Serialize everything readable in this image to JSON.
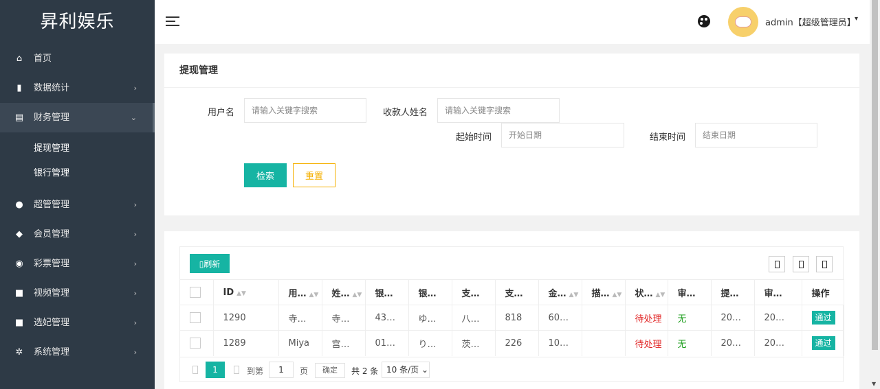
{
  "sidebar": {
    "logo": "昇利娱乐",
    "items": [
      {
        "label": "首页",
        "icon": "home-icon",
        "glyph": "⌂",
        "arrow": ""
      },
      {
        "label": "数据统计",
        "icon": "bar-chart-icon",
        "glyph": "▮",
        "arrow": "›"
      },
      {
        "label": "财务管理",
        "icon": "bank-icon",
        "glyph": "▤",
        "arrow": "⌄"
      },
      {
        "label": "超管管理",
        "icon": "user-icon",
        "glyph": "●",
        "arrow": "›"
      },
      {
        "label": "会员管理",
        "icon": "users-icon",
        "glyph": "◆",
        "arrow": "›"
      },
      {
        "label": "彩票管理",
        "icon": "gamepad-icon",
        "glyph": "◉",
        "arrow": "›"
      },
      {
        "label": "视频管理",
        "icon": "video-icon",
        "glyph": "■",
        "arrow": "›"
      },
      {
        "label": "选妃管理",
        "icon": "video-icon",
        "glyph": "■",
        "arrow": "›"
      },
      {
        "label": "系统管理",
        "icon": "gear-icon",
        "glyph": "✲",
        "arrow": "›"
      }
    ],
    "subitems": [
      {
        "label": "提现管理"
      },
      {
        "label": "银行管理"
      }
    ]
  },
  "header": {
    "user": "admin【超级管理员】",
    "caret": "▾"
  },
  "search": {
    "title": "提现管理",
    "username_label": "用户名",
    "username_placeholder": "请输入关键字搜索",
    "payee_label": "收款人姓名",
    "payee_placeholder": "请输入关键字搜索",
    "start_label": "起始时间",
    "start_placeholder": "开始日期",
    "end_label": "结束时间",
    "end_placeholder": "结束日期",
    "search_btn": "检索",
    "reset_btn": "重置"
  },
  "table": {
    "refresh_btn": "▯刷新",
    "columns": [
      "ID",
      "用…",
      "姓…",
      "银…",
      "银…",
      "支…",
      "支…",
      "金…",
      "描…",
      "状…",
      "审…",
      "提…",
      "审…",
      "操作"
    ],
    "rows": [
      {
        "id": "1290",
        "user": "寺…",
        "name": "寺…",
        "bank1": "43…",
        "bank2": "ゆ…",
        "pay1": "八…",
        "pay2": "818",
        "amount": "60…",
        "desc": "",
        "status": "待处理",
        "review": "无",
        "time1": "20…",
        "time2": "20…",
        "action": "通过"
      },
      {
        "id": "1289",
        "user": "Miya",
        "name": "宫…",
        "bank1": "01…",
        "bank2": "り…",
        "pay1": "茨…",
        "pay2": "226",
        "amount": "10…",
        "desc": "",
        "status": "待处理",
        "review": "无",
        "time1": "20…",
        "time2": "20…",
        "action": "通过"
      }
    ],
    "pager": {
      "current": "1",
      "goto_label": "到第",
      "goto_value": "1",
      "page_unit": "页",
      "ok": "确定",
      "total": "共 2 条",
      "size": "10 条/页 ⌄"
    }
  }
}
